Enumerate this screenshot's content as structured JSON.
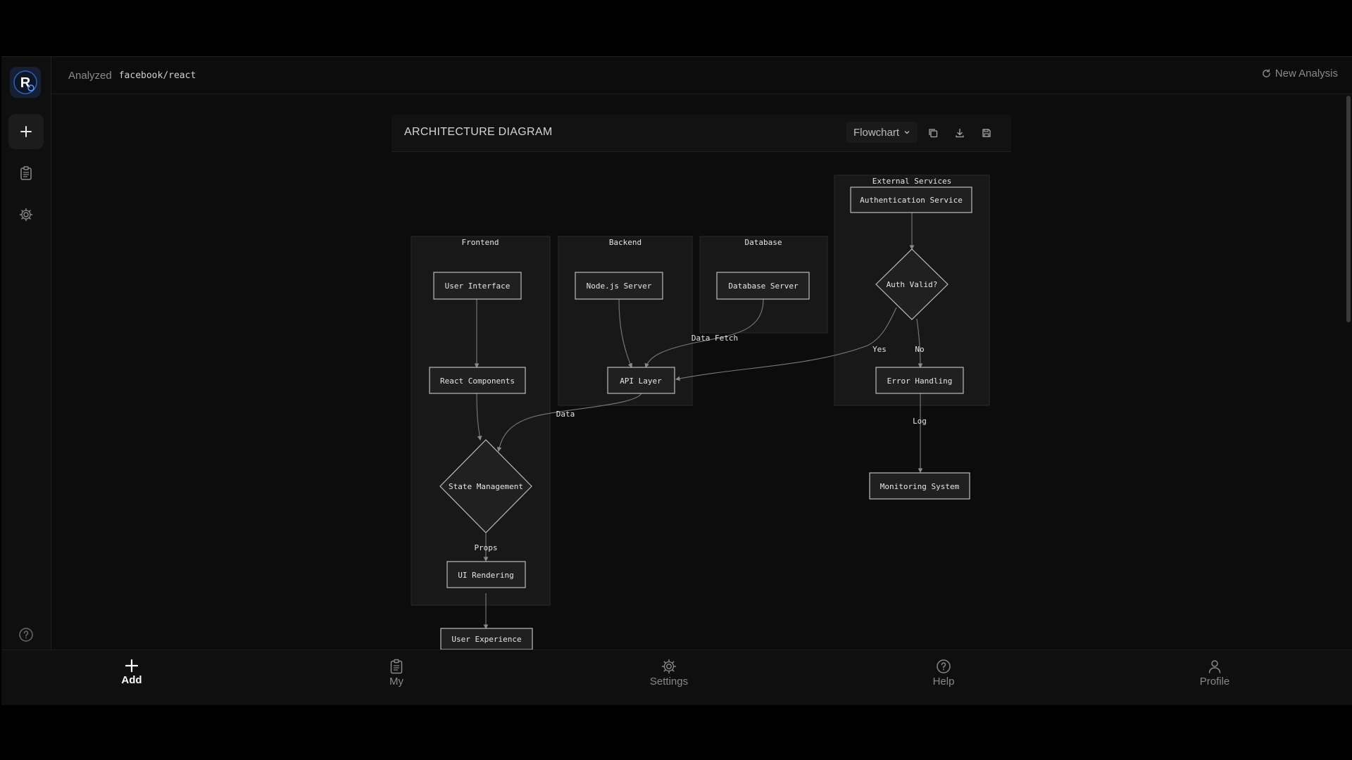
{
  "header": {
    "analyzed_label": "Analyzed",
    "repo": "facebook/react",
    "new_analysis": "New Analysis"
  },
  "sidebar": {
    "items": [
      {
        "icon": "plus-icon",
        "active": true
      },
      {
        "icon": "clipboard-icon",
        "active": false
      },
      {
        "icon": "gear-icon",
        "active": false
      }
    ],
    "help_icon": "help-icon"
  },
  "panel": {
    "title": "ARCHITECTURE DIAGRAM",
    "view_select": "Flowchart",
    "tools": [
      "copy-icon",
      "download-icon",
      "save-icon"
    ]
  },
  "diagram": {
    "groups": {
      "frontend": "Frontend",
      "backend": "Backend",
      "database": "Database",
      "external": "External Services"
    },
    "nodes": {
      "user_interface": "User Interface",
      "react_components": "React Components",
      "state_management": "State Management",
      "ui_rendering": "UI Rendering",
      "user_experience": "User Experience",
      "nodejs_server": "Node.js Server",
      "api_layer": "API Layer",
      "database_server": "Database Server",
      "auth_service": "Authentication Service",
      "auth_valid": "Auth Valid?",
      "error_handling": "Error Handling",
      "monitoring_system": "Monitoring System"
    },
    "edge_labels": {
      "data_fetch": "Data Fetch",
      "data": "Data",
      "props": "Props",
      "yes": "Yes",
      "no": "No",
      "log": "Log"
    }
  },
  "bottom_nav": [
    {
      "label": "Add",
      "icon": "plus-icon",
      "active": true
    },
    {
      "label": "My",
      "icon": "clipboard-icon",
      "active": false
    },
    {
      "label": "Settings",
      "icon": "gear-icon",
      "active": false
    },
    {
      "label": "Help",
      "icon": "help-icon",
      "active": false
    },
    {
      "label": "Profile",
      "icon": "user-icon",
      "active": false
    }
  ],
  "colors": {
    "background": "#0c0c0c",
    "node_fill": "#202020",
    "node_stroke": "#bcbcbc",
    "logo_accent": "#3b82f6"
  }
}
